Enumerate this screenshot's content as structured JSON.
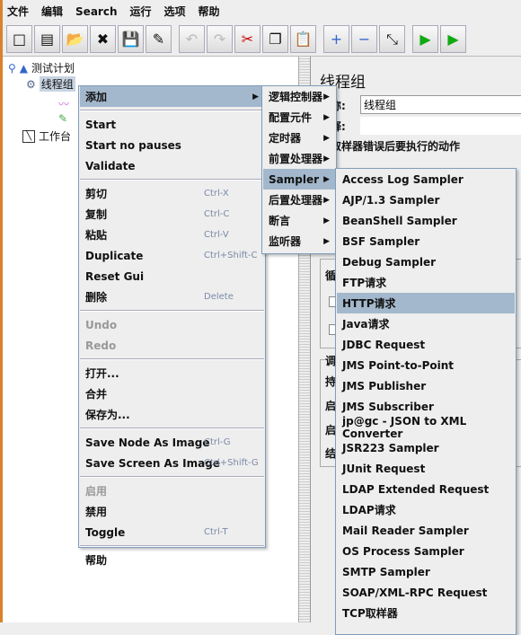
{
  "menubar": [
    "文件",
    "编辑",
    "Search",
    "运行",
    "选项",
    "帮助"
  ],
  "toolbar": [
    {
      "icon": "new-icon",
      "g": "□"
    },
    {
      "icon": "templates-icon",
      "g": "▤"
    },
    {
      "icon": "open-icon",
      "g": "📂"
    },
    {
      "icon": "close-icon",
      "g": "✖"
    },
    {
      "icon": "save-icon",
      "g": "💾"
    },
    {
      "icon": "save-as-icon",
      "g": "✎"
    },
    {
      "sep": true
    },
    {
      "icon": "undo-icon",
      "g": "↶"
    },
    {
      "icon": "redo-icon",
      "g": "↷"
    },
    {
      "icon": "cut-icon",
      "g": "✂"
    },
    {
      "icon": "copy-icon",
      "g": "❐"
    },
    {
      "icon": "paste-icon",
      "g": "📋"
    },
    {
      "sep": true
    },
    {
      "icon": "expand-icon",
      "g": "+"
    },
    {
      "icon": "collapse-icon",
      "g": "−"
    },
    {
      "icon": "toggle-icon",
      "g": "⤡"
    },
    {
      "sep": true
    },
    {
      "icon": "start-icon",
      "g": "▶"
    },
    {
      "icon": "start-no-pauses-icon",
      "g": "▶"
    }
  ],
  "tree": {
    "test_plan": "测试计划",
    "thread_group": "线程组",
    "workbench": "工作台"
  },
  "panel": {
    "title": "线程组",
    "name_label": "名称:",
    "name_value": "线程组",
    "comment_label": "注释:",
    "error_action": "在取样器错误后要执行的动作",
    "loop_label": "循环",
    "scheduler_label": "调",
    "duration": "持",
    "start_delay": "启",
    "start_time": "启",
    "end_time": "结"
  },
  "context_menu": [
    {
      "label": "添加",
      "submenu": true,
      "hl": true
    },
    {
      "sep": true
    },
    {
      "label": "Start"
    },
    {
      "label": "Start no pauses"
    },
    {
      "label": "Validate"
    },
    {
      "sep": true
    },
    {
      "label": "剪切",
      "sc": "Ctrl-X"
    },
    {
      "label": "复制",
      "sc": "Ctrl-C"
    },
    {
      "label": "粘贴",
      "sc": "Ctrl-V"
    },
    {
      "label": "Duplicate",
      "sc": "Ctrl+Shift-C"
    },
    {
      "label": "Reset Gui"
    },
    {
      "label": "删除",
      "sc": "Delete"
    },
    {
      "sep": true
    },
    {
      "label": "Undo",
      "dis": true
    },
    {
      "label": "Redo",
      "dis": true
    },
    {
      "sep": true
    },
    {
      "label": "打开..."
    },
    {
      "label": "合并"
    },
    {
      "label": "保存为..."
    },
    {
      "sep": true
    },
    {
      "label": "Save Node As Image",
      "sc": "Ctrl-G"
    },
    {
      "label": "Save Screen As Image",
      "sc": "Ctrl+Shift-G"
    },
    {
      "sep": true
    },
    {
      "label": "启用",
      "dis": true
    },
    {
      "label": "禁用"
    },
    {
      "label": "Toggle",
      "sc": "Ctrl-T"
    },
    {
      "sep": true
    },
    {
      "label": "帮助"
    }
  ],
  "add_submenu": [
    {
      "label": "逻辑控制器",
      "submenu": true
    },
    {
      "label": "配置元件",
      "submenu": true
    },
    {
      "label": "定时器",
      "submenu": true
    },
    {
      "label": "前置处理器",
      "submenu": true
    },
    {
      "label": "Sampler",
      "submenu": true,
      "hl": true
    },
    {
      "label": "后置处理器",
      "submenu": true
    },
    {
      "label": "断言",
      "submenu": true
    },
    {
      "label": "监听器",
      "submenu": true
    }
  ],
  "sampler_submenu": [
    {
      "label": "Access Log Sampler"
    },
    {
      "label": "AJP/1.3 Sampler"
    },
    {
      "label": "BeanShell Sampler"
    },
    {
      "label": "BSF Sampler"
    },
    {
      "label": "Debug Sampler"
    },
    {
      "label": "FTP请求"
    },
    {
      "label": "HTTP请求",
      "hl": true
    },
    {
      "label": "Java请求"
    },
    {
      "label": "JDBC Request"
    },
    {
      "label": "JMS Point-to-Point"
    },
    {
      "label": "JMS Publisher"
    },
    {
      "label": "JMS Subscriber"
    },
    {
      "label": "jp@gc - JSON to XML Converter"
    },
    {
      "label": "JSR223 Sampler"
    },
    {
      "label": "JUnit Request"
    },
    {
      "label": "LDAP Extended Request"
    },
    {
      "label": "LDAP请求"
    },
    {
      "label": "Mail Reader Sampler"
    },
    {
      "label": "OS Process Sampler"
    },
    {
      "label": "SMTP Sampler"
    },
    {
      "label": "SOAP/XML-RPC Request"
    },
    {
      "label": "TCP取样器"
    }
  ],
  "colors": {
    "highlight": "#a3b8cc",
    "menu_border": "#7f9db9",
    "frame": "#d9822b"
  }
}
